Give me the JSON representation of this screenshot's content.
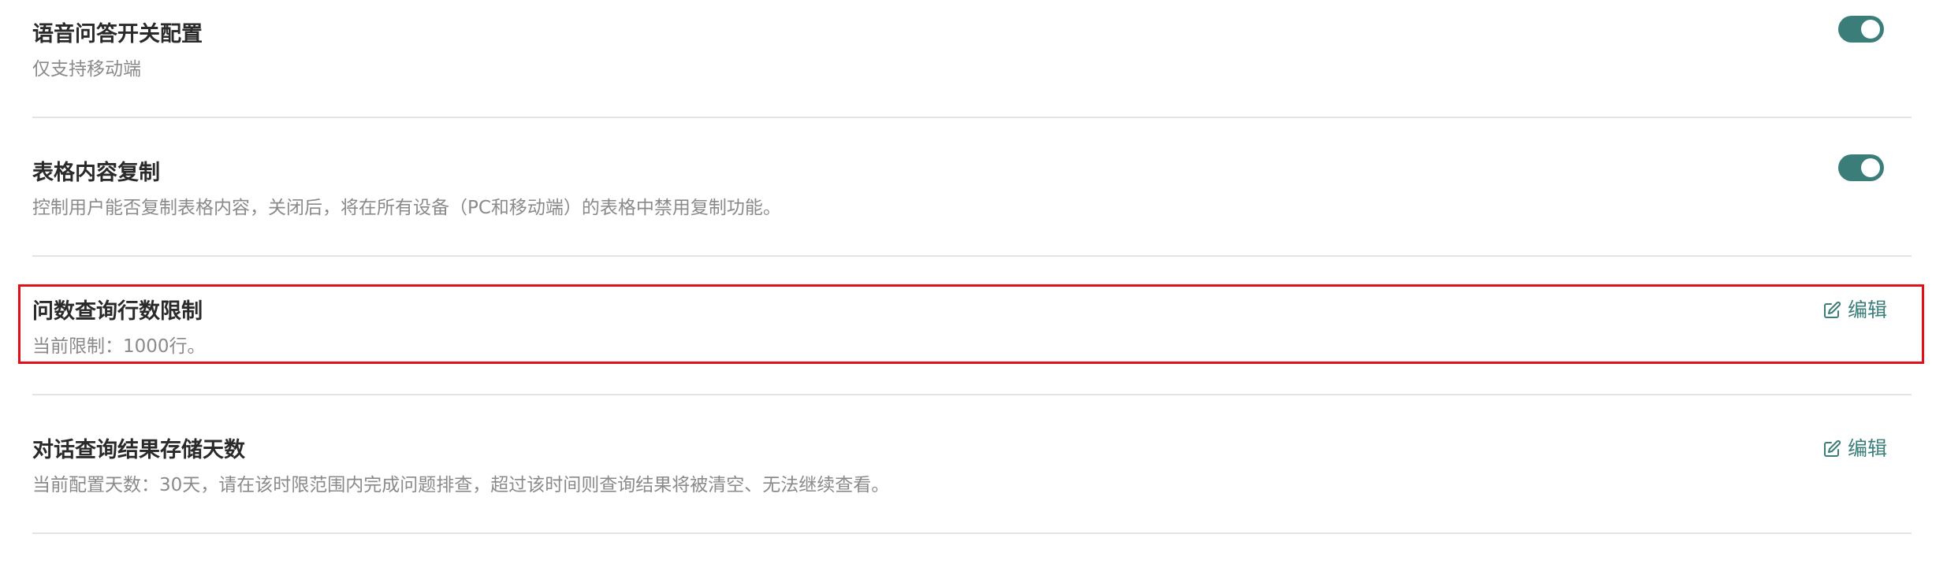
{
  "settings": {
    "items": [
      {
        "title": "语音问答开关配置",
        "description": "仅支持移动端",
        "control": "toggle",
        "enabled": true
      },
      {
        "title": "表格内容复制",
        "description": "控制用户能否复制表格内容，关闭后，将在所有设备（PC和移动端）的表格中禁用复制功能。",
        "control": "toggle",
        "enabled": true
      },
      {
        "title": "问数查询行数限制",
        "description": "当前限制：1000行。",
        "control": "edit",
        "edit_label": "编辑",
        "highlighted": true
      },
      {
        "title": "对话查询结果存储天数",
        "description": "当前配置天数：30天，请在该时限范围内完成问题排查，超过该时间则查询结果将被清空、无法继续查看。",
        "control": "edit",
        "edit_label": "编辑"
      }
    ]
  },
  "colors": {
    "accent": "#3a7d79",
    "title_text": "#2a2a2a",
    "description_text": "#8a8a8a",
    "divider": "#e4e4e4",
    "highlight_border": "#e3101a"
  },
  "icons": {
    "edit": "edit-pencil-icon"
  }
}
